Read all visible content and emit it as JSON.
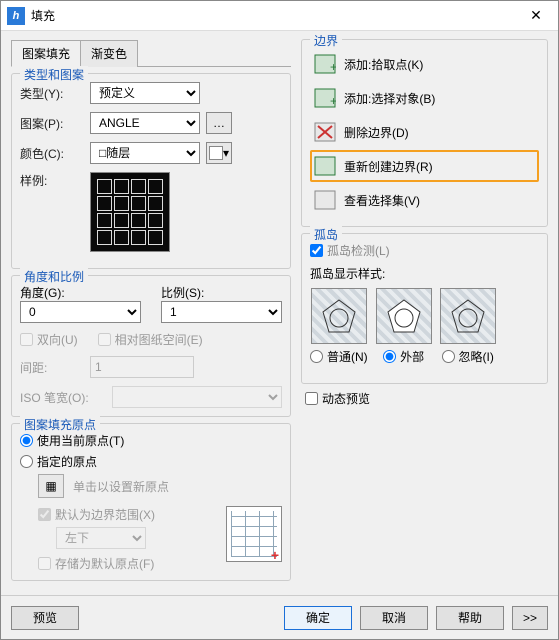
{
  "window": {
    "title": "填充",
    "close": "✕"
  },
  "tabs": {
    "fill": "图案填充",
    "grad": "渐变色"
  },
  "typeGroup": {
    "legend": "类型和图案",
    "typeLabel": "类型(Y):",
    "typeValue": "预定义",
    "patternLabel": "图案(P):",
    "patternValue": "ANGLE",
    "colorLabel": "颜色(C):",
    "colorValue": "□随层",
    "sampleLabel": "样例:"
  },
  "angleGroup": {
    "legend": "角度和比例",
    "angleLabel": "角度(G):",
    "angleValue": "0",
    "scaleLabel": "比例(S):",
    "scaleValue": "1",
    "bidir": "双向(U)",
    "relpaper": "相对图纸空间(E)",
    "spacingLabel": "间距:",
    "spacingValue": "1",
    "isoLabel": "ISO 笔宽(O):"
  },
  "originGroup": {
    "legend": "图案填充原点",
    "useCurrent": "使用当前原点(T)",
    "specify": "指定的原点",
    "clickSet": "单击以设置新原点",
    "defaultExtent": "默认为边界范围(X)",
    "corner": "左下",
    "storeDefault": "存储为默认原点(F)"
  },
  "boundary": {
    "legend": "边界",
    "pick": "添加:拾取点(K)",
    "select": "添加:选择对象(B)",
    "delete": "删除边界(D)",
    "recreate": "重新创建边界(R)",
    "view": "查看选择集(V)"
  },
  "island": {
    "legend": "孤岛",
    "detect": "孤岛检测(L)",
    "styleLabel": "孤岛显示样式:",
    "normal": "普通(N)",
    "outer": "外部",
    "ignore": "忽略(I)"
  },
  "dynamic": "动态预览",
  "footer": {
    "preview": "预览",
    "ok": "确定",
    "cancel": "取消",
    "help": "帮助",
    "expand": ">>"
  }
}
